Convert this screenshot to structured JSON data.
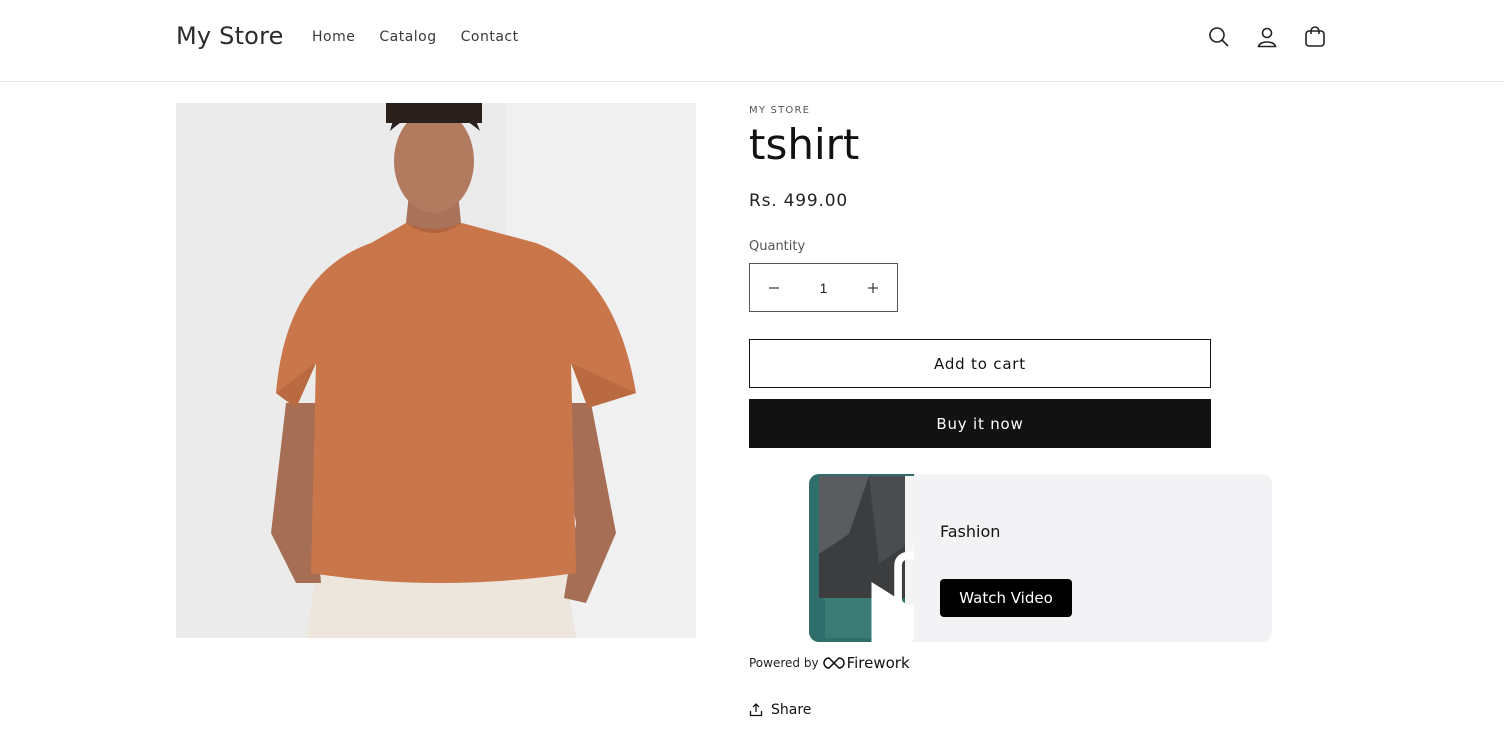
{
  "header": {
    "logo": "My Store",
    "nav": [
      {
        "label": "Home"
      },
      {
        "label": "Catalog"
      },
      {
        "label": "Contact"
      }
    ],
    "icons": [
      "search-icon",
      "account-icon",
      "cart-icon"
    ]
  },
  "product": {
    "vendor": "MY STORE",
    "title": "tshirt",
    "price": "Rs. 499.00",
    "quantity_label": "Quantity",
    "quantity_value": "1",
    "add_to_cart_label": "Add to cart",
    "buy_now_label": "Buy it now",
    "image_colors": {
      "shirt": "#c9764a",
      "background": "#ecebec"
    }
  },
  "video_widget": {
    "caption": "Fashion",
    "watch_label": "Watch Video",
    "powered_label": "Powered by",
    "brand": "Firework",
    "thumb_color": "#2f6e6b"
  },
  "share_label": "Share"
}
